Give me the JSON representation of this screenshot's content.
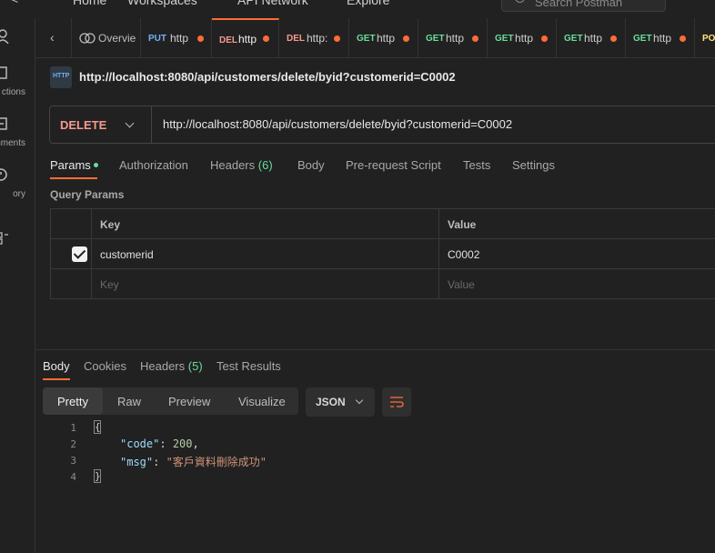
{
  "topnav": {
    "items": [
      "Home",
      "Workspaces",
      "API Network",
      "Explore"
    ],
    "search_placeholder": "Search Postman"
  },
  "sidebar": {
    "items": [
      {
        "label": "",
        "icon": "user-icon"
      },
      {
        "label": "ctions",
        "icon": "collections-icon"
      },
      {
        "label": "nments",
        "icon": "environments-icon"
      },
      {
        "label": "ory",
        "icon": "history-icon"
      },
      {
        "label": "",
        "icon": "add-workspace-icon"
      }
    ]
  },
  "tabs": [
    {
      "method": "",
      "name": "Overvie",
      "dot": false,
      "icon": "overview-icon"
    },
    {
      "method": "PUT",
      "name": "http",
      "dot": true
    },
    {
      "method": "DEL",
      "name": "http",
      "dot": true,
      "active": true
    },
    {
      "method": "DEL",
      "name": "http:",
      "dot": true
    },
    {
      "method": "GET",
      "name": "http",
      "dot": true
    },
    {
      "method": "GET",
      "name": "http",
      "dot": true
    },
    {
      "method": "GET",
      "name": "http",
      "dot": true
    },
    {
      "method": "GET",
      "name": "http",
      "dot": true
    },
    {
      "method": "GET",
      "name": "http",
      "dot": true
    },
    {
      "method": "POS",
      "name": "",
      "dot": false
    }
  ],
  "request": {
    "title": "http://localhost:8080/api/customers/delete/byid?customerid=C0002",
    "method": "DELETE",
    "url": "http://localhost:8080/api/customers/delete/byid?customerid=C0002",
    "icon_label": "HTTP"
  },
  "request_tabs": {
    "params": "Params",
    "authorization": "Authorization",
    "headers": "Headers",
    "headers_count": "(6)",
    "body": "Body",
    "prerequest": "Pre-request Script",
    "tests": "Tests",
    "settings": "Settings"
  },
  "query_params": {
    "label": "Query Params",
    "key_header": "Key",
    "value_header": "Value",
    "rows": [
      {
        "key": "customerid",
        "value": "C0002",
        "checked": true
      }
    ],
    "key_placeholder": "Key",
    "value_placeholder": "Value"
  },
  "response_tabs": {
    "body": "Body",
    "cookies": "Cookies",
    "headers": "Headers",
    "headers_count": "(5)",
    "test_results": "Test Results"
  },
  "view_modes": [
    "Pretty",
    "Raw",
    "Preview",
    "Visualize"
  ],
  "format": "JSON",
  "code": {
    "line_numbers": [
      "1",
      "2",
      "3",
      "4"
    ],
    "open_brace": "{",
    "close_brace": "}",
    "code_key": "\"code\"",
    "code_value": "200",
    "msg_key": "\"msg\"",
    "msg_value": "\"客戶資料刪除成功\"",
    "colon": ": ",
    "comma": ","
  },
  "colors": {
    "accent": "#ff6c37",
    "get": "#6bdd9a",
    "put": "#74aef6",
    "delete": "#f79a8e"
  }
}
